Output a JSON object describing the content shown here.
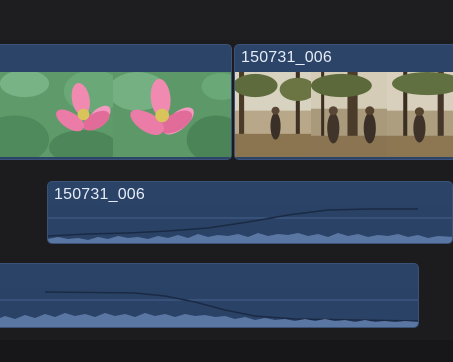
{
  "timeline": {
    "video_track": {
      "clips": [
        {
          "title": "",
          "content": "lotus-flower"
        },
        {
          "title": "150731_006",
          "content": "forest-walkers"
        }
      ]
    },
    "audio_track_1": {
      "title": "150731_006"
    },
    "audio_track_2": {
      "title": ""
    }
  }
}
